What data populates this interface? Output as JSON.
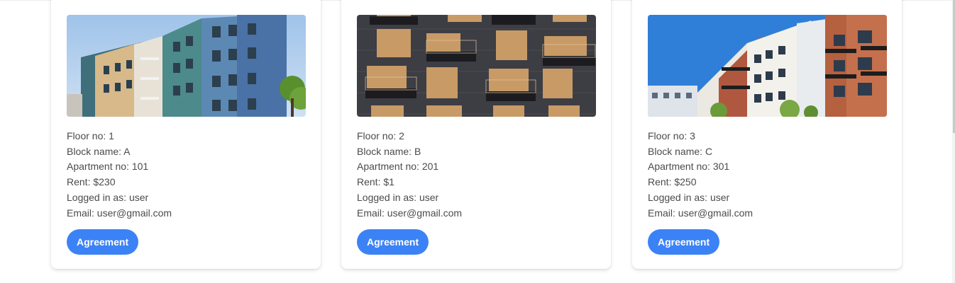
{
  "labels": {
    "floor": "Floor no: ",
    "block": "Block name: ",
    "apartment": "Apartment no: ",
    "rent": "Rent: ",
    "logged": "Logged in as: ",
    "email": "Email: "
  },
  "cards": [
    {
      "floor": "1",
      "block": "A",
      "apartment": "101",
      "rent": "$230",
      "user": "user",
      "email": "user@gmail.com",
      "button": "Agreement",
      "image": "apartment-building-photo"
    },
    {
      "floor": "2",
      "block": "B",
      "apartment": "201",
      "rent": "$1",
      "user": "user",
      "email": "user@gmail.com",
      "button": "Agreement",
      "image": "apartment-facade-photo"
    },
    {
      "floor": "3",
      "block": "C",
      "apartment": "301",
      "rent": "$250",
      "user": "user",
      "email": "user@gmail.com",
      "button": "Agreement",
      "image": "apartment-complex-photo"
    }
  ],
  "colors": {
    "accent": "#3b82f6",
    "text": "#4b4b4b",
    "card_bg": "#ffffff"
  }
}
